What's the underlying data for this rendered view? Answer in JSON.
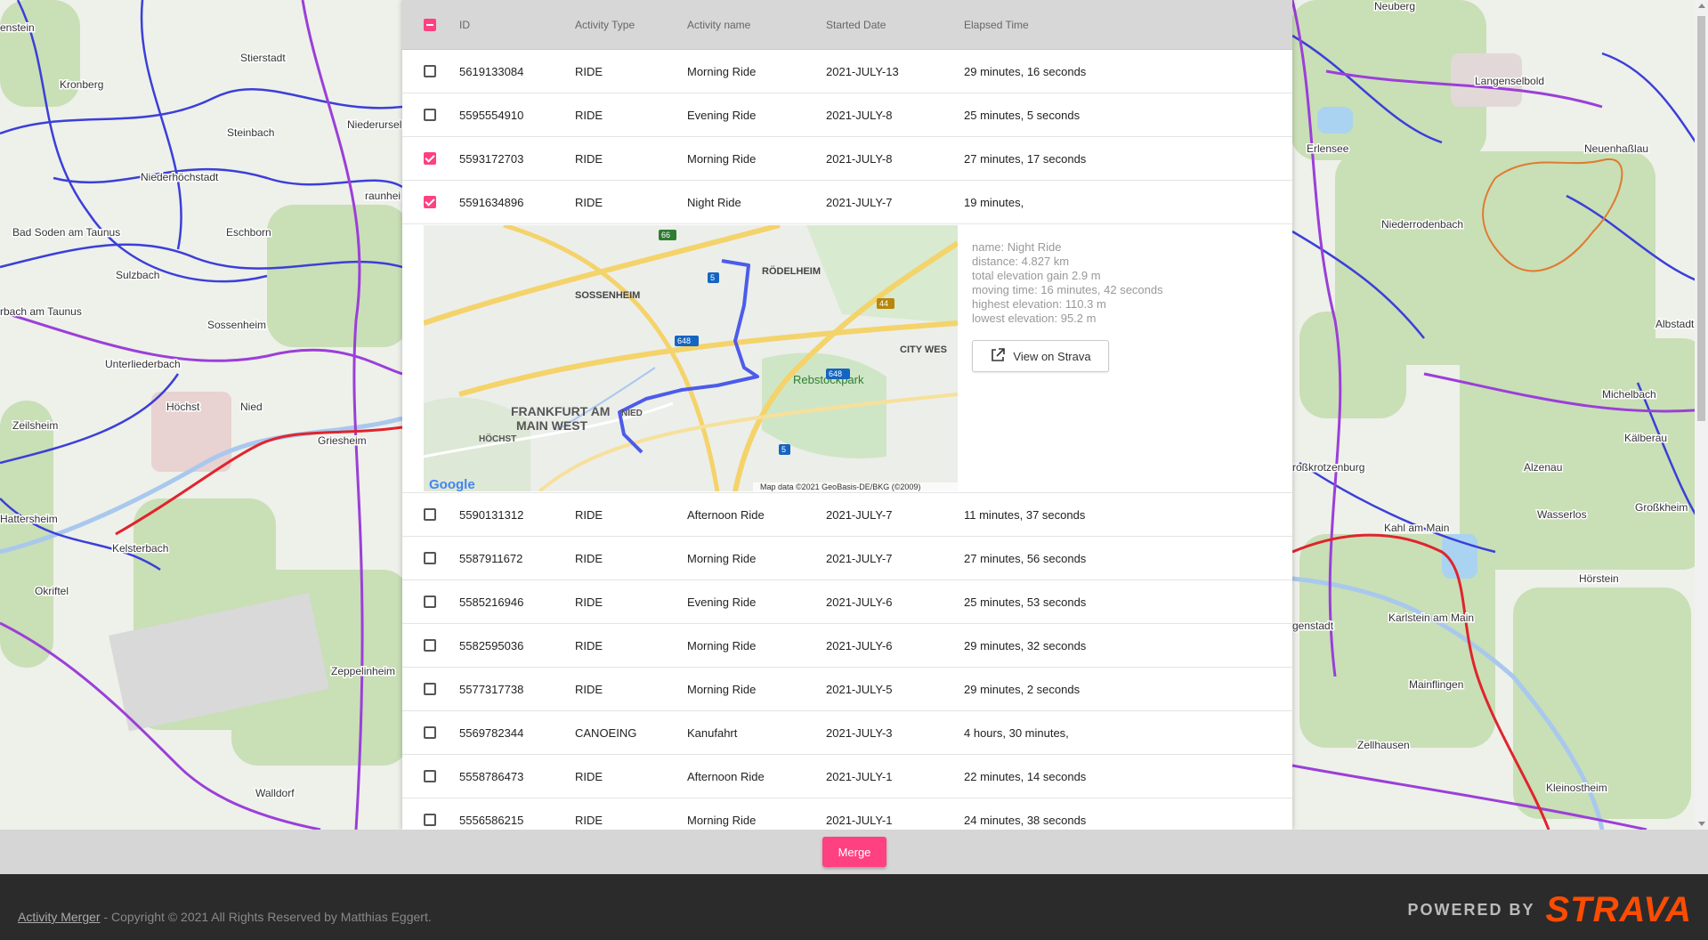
{
  "table": {
    "headers": {
      "id": "ID",
      "type": "Activity Type",
      "name": "Activity name",
      "date": "Started Date",
      "time": "Elapsed Time"
    },
    "rows_top": [
      {
        "id": "5619133084",
        "type": "RIDE",
        "name": "Morning Ride",
        "date": "2021-JULY-13",
        "time": "29 minutes, 16 seconds",
        "checked": false
      },
      {
        "id": "5595554910",
        "type": "RIDE",
        "name": "Evening Ride",
        "date": "2021-JULY-8",
        "time": "25 minutes, 5 seconds",
        "checked": false
      },
      {
        "id": "5593172703",
        "type": "RIDE",
        "name": "Morning Ride",
        "date": "2021-JULY-8",
        "time": "27 minutes, 17 seconds",
        "checked": true
      },
      {
        "id": "5591634896",
        "type": "RIDE",
        "name": "Night Ride",
        "date": "2021-JULY-7",
        "time": "19 minutes,",
        "checked": true
      }
    ],
    "rows_bottom": [
      {
        "id": "5590131312",
        "type": "RIDE",
        "name": "Afternoon Ride",
        "date": "2021-JULY-7",
        "time": "11 minutes, 37 seconds",
        "checked": false
      },
      {
        "id": "5587911672",
        "type": "RIDE",
        "name": "Morning Ride",
        "date": "2021-JULY-7",
        "time": "27 minutes, 56 seconds",
        "checked": false
      },
      {
        "id": "5585216946",
        "type": "RIDE",
        "name": "Evening Ride",
        "date": "2021-JULY-6",
        "time": "25 minutes, 53 seconds",
        "checked": false
      },
      {
        "id": "5582595036",
        "type": "RIDE",
        "name": "Morning Ride",
        "date": "2021-JULY-6",
        "time": "29 minutes, 32 seconds",
        "checked": false
      },
      {
        "id": "5577317738",
        "type": "RIDE",
        "name": "Morning Ride",
        "date": "2021-JULY-5",
        "time": "29 minutes, 2 seconds",
        "checked": false
      },
      {
        "id": "5569782344",
        "type": "CANOEING",
        "name": "Kanufahrt",
        "date": "2021-JULY-3",
        "time": "4 hours, 30 minutes,",
        "checked": false
      },
      {
        "id": "5558786473",
        "type": "RIDE",
        "name": "Afternoon Ride",
        "date": "2021-JULY-1",
        "time": "22 minutes, 14 seconds",
        "checked": false
      },
      {
        "id": "5556586215",
        "type": "RIDE",
        "name": "Morning Ride",
        "date": "2021-JULY-1",
        "time": "24 minutes, 38 seconds",
        "checked": false
      }
    ]
  },
  "detail": {
    "stats": [
      "name: Night Ride",
      "distance: 4.827 km",
      "total elevation gain 2.9 m",
      "moving time: 16 minutes, 42 seconds",
      "highest elevation: 110.3 m",
      "lowest elevation: 95.2 m"
    ],
    "view_on_strava": "View on Strava",
    "map": {
      "labels": [
        "RÖDELHEIM",
        "SOSSENHEIM",
        "CITY WES",
        "Rebstockpark",
        "FRANKFURT AM",
        "MAIN WEST",
        "NIED",
        "HÖCHST"
      ],
      "road_badges": [
        "66",
        "5",
        "44",
        "648",
        "648",
        "5"
      ],
      "attribution": "Map data ©2021 GeoBasis-DE/BKG (©2009)",
      "google": "Google"
    }
  },
  "actions": {
    "merge": "Merge"
  },
  "footer": {
    "app_link": "Activity Merger",
    "copyright": " - Copyright © 2021 All Rights Reserved by Matthias Eggert.",
    "powered_by": "POWERED BY",
    "strava": "STRAVA"
  },
  "background_map": {
    "places_left": [
      "Stierstadt",
      "Kronberg",
      "Steinbach",
      "Niederursel",
      "Niederhöchstadt",
      "Bad Soden am Taunus",
      "Eschborn",
      "Sulzbach",
      "Sossenheim",
      "Unterliederbach",
      "Höchst",
      "Nied",
      "Zeilsheim",
      "Griesheim",
      "Hattersheim",
      "Kelsterbach",
      "Okriftel",
      "Zeppelinheim",
      "Walldorf",
      "rbach am Taunus",
      "raunhei",
      "enstein"
    ],
    "places_right": [
      "Neuberg",
      "Langenselbold",
      "Erlensee",
      "Neuenhaßlau",
      "Niederrodenbach",
      "Albstadt",
      "Michelbach",
      "Kälberau",
      "roßkrotzenburg",
      "Alzenau",
      "Wasserlos",
      "Großkheim",
      "Kahl am Main",
      "Hörstein",
      "genstadt",
      "Karlstein am Main",
      "Mainflingen",
      "Zellhausen",
      "Kleinostheim"
    ],
    "colors": {
      "primary": "#ff4081",
      "route": "#4d5bea",
      "strava": "#fc4c02"
    }
  }
}
